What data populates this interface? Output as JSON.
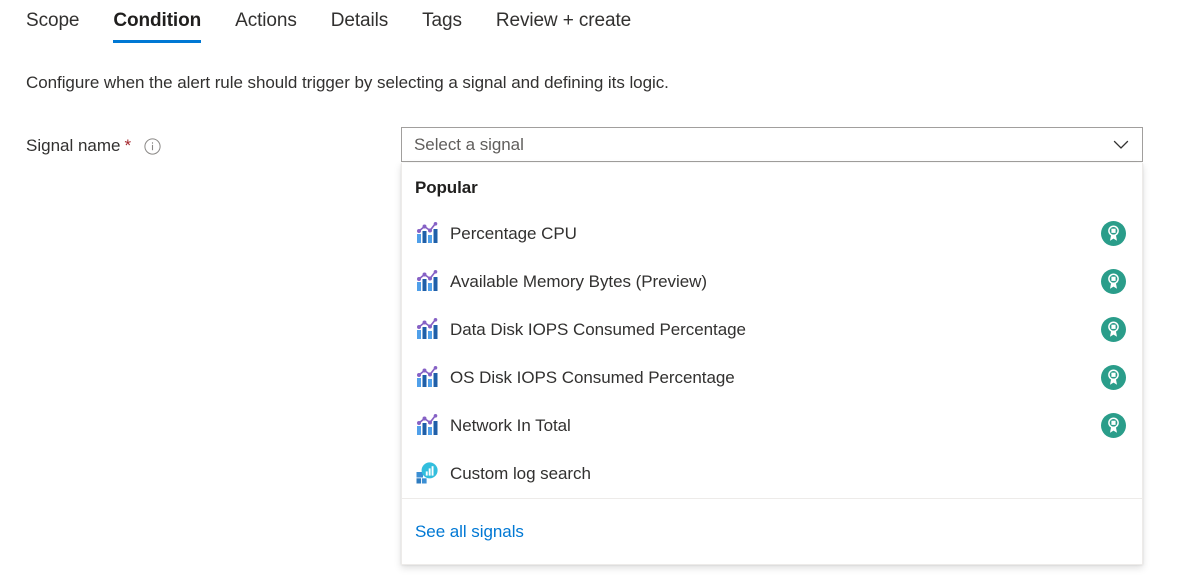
{
  "tabs": [
    {
      "label": "Scope",
      "active": false
    },
    {
      "label": "Condition",
      "active": true
    },
    {
      "label": "Actions",
      "active": false
    },
    {
      "label": "Details",
      "active": false
    },
    {
      "label": "Tags",
      "active": false
    },
    {
      "label": "Review + create",
      "active": false
    }
  ],
  "description": "Configure when the alert rule should trigger by selecting a signal and defining its logic.",
  "field": {
    "label": "Signal name",
    "required_marker": "*",
    "info_icon": "info-circle-icon"
  },
  "signal_combobox": {
    "placeholder": "Select a signal",
    "value": "",
    "chevron_icon": "chevron-down-icon"
  },
  "dropdown": {
    "group_header": "Popular",
    "options": [
      {
        "label": "Percentage CPU",
        "icon": "metric-chart-icon",
        "badge": "platform-metric-badge-icon"
      },
      {
        "label": "Available Memory Bytes (Preview)",
        "icon": "metric-chart-icon",
        "badge": "platform-metric-badge-icon"
      },
      {
        "label": "Data Disk IOPS Consumed Percentage",
        "icon": "metric-chart-icon",
        "badge": "platform-metric-badge-icon"
      },
      {
        "label": "OS Disk IOPS Consumed Percentage",
        "icon": "metric-chart-icon",
        "badge": "platform-metric-badge-icon"
      },
      {
        "label": "Network In Total",
        "icon": "metric-chart-icon",
        "badge": "platform-metric-badge-icon"
      },
      {
        "label": "Custom log search",
        "icon": "log-search-icon",
        "badge": ""
      }
    ],
    "footer_link": "See all signals"
  },
  "colors": {
    "accent": "#0078d4",
    "required": "#a4262c",
    "badge_teal": "#2a9d8a",
    "text_primary": "#323130",
    "text_secondary": "#605e5c",
    "border": "#a19f9d"
  }
}
